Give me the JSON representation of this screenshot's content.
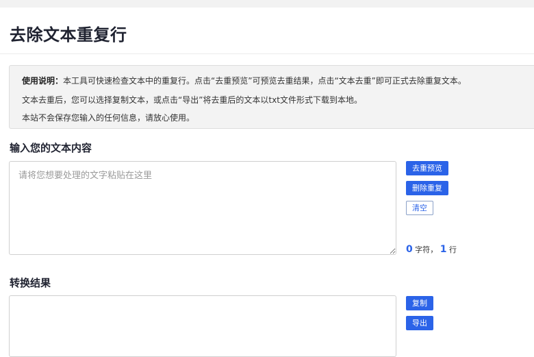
{
  "page": {
    "title": "去除文本重复行"
  },
  "info": {
    "label": "使用说明：",
    "line1": "本工具可快速检查文本中的重复行。点击“去重预览”可预览去重结果，点击“文本去重”即可正式去除重复文本。",
    "line2": "文本去重后，您可以选择复制文本，或点击“导出”将去重后的文本以txt文件形式下载到本地。",
    "line3": "本站不会保存您输入的任何信息，请放心使用。"
  },
  "input_section": {
    "heading": "输入您的文本内容",
    "placeholder": "请将您想要处理的文字粘贴在这里",
    "value": ""
  },
  "buttons": {
    "preview": "去重预览",
    "dedupe": "删除重复",
    "clear": "清空",
    "copy": "复制",
    "export": "导出"
  },
  "counter": {
    "chars": "0",
    "chars_unit": "字符，",
    "lines": "1",
    "lines_unit": "行"
  },
  "result_section": {
    "heading": "转换结果",
    "value": ""
  },
  "colors": {
    "accent": "#2b63e8",
    "info_bg": "#f3f3f3",
    "title": "#1f2230"
  }
}
